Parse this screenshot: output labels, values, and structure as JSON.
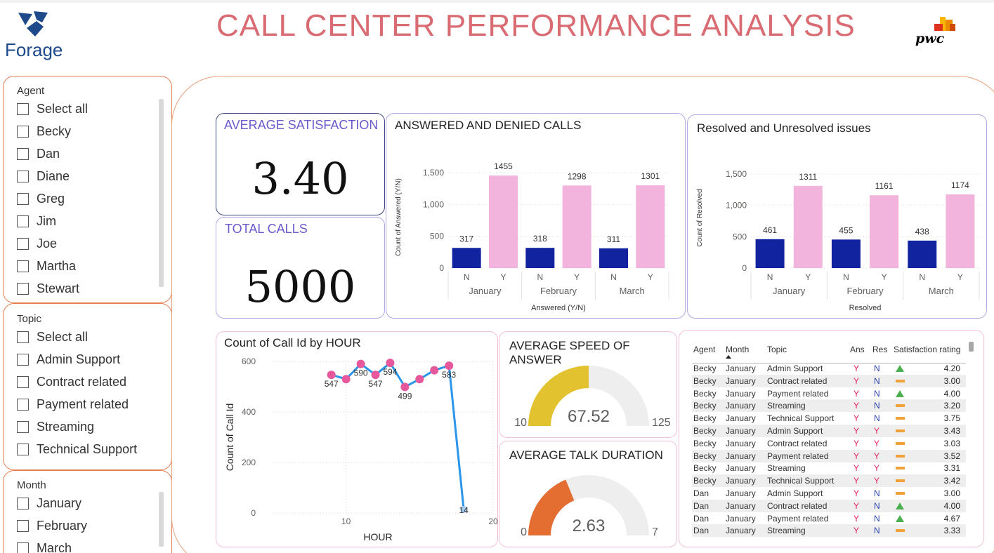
{
  "header": {
    "title": "CALL CENTER PERFORMANCE ANALYSIS",
    "logo_text": "Forage",
    "partner_logo_text": "pwc"
  },
  "slicers": {
    "agent": {
      "title": "Agent",
      "options": [
        "Select all",
        "Becky",
        "Dan",
        "Diane",
        "Greg",
        "Jim",
        "Joe",
        "Martha",
        "Stewart"
      ]
    },
    "topic": {
      "title": "Topic",
      "options": [
        "Select all",
        "Admin Support",
        "Contract related",
        "Payment related",
        "Streaming",
        "Technical Support"
      ]
    },
    "month": {
      "title": "Month",
      "options": [
        "January",
        "February",
        "March"
      ]
    }
  },
  "kpis": {
    "avg_satisfaction": {
      "label": "AVERAGE SATISFACTION",
      "value": "3.40"
    },
    "total_calls": {
      "label": "TOTAL CALLS",
      "value": "5000"
    }
  },
  "gauges": {
    "speed": {
      "label": "AVERAGE SPEED OF ANSWER",
      "min": "10",
      "max": "125",
      "value": "67.52",
      "value_num": 67.52,
      "color": "#e3c22f"
    },
    "talk": {
      "label": "AVERAGE TALK DURATION",
      "min": "0",
      "max": "7",
      "value": "2.63",
      "value_num": 2.63,
      "color": "#e46d32"
    }
  },
  "colors": {
    "dark_bar": "#1223a0",
    "pink_bar": "#f2b3dc",
    "line": "#2b95e9",
    "marker": "#e6579b",
    "accent": "#6a5acd"
  },
  "chart_data": [
    {
      "id": "answered",
      "type": "bar",
      "title": "ANSWERED AND DENIED CALLS",
      "xlabel": "Answered (Y/N)",
      "ylabel": "Count of Answered (Y/N)",
      "ylim": [
        0,
        1600
      ],
      "yticks": [
        "0",
        "500",
        "1,000",
        "1,500"
      ],
      "ytick_values": [
        0,
        500,
        1000,
        1500
      ],
      "groups": [
        "January",
        "February",
        "March"
      ],
      "categories": [
        "N",
        "Y",
        "N",
        "Y",
        "N",
        "Y"
      ],
      "values": [
        317,
        1455,
        318,
        1298,
        311,
        1301
      ],
      "labels": [
        "317",
        "1455",
        "318",
        "1298",
        "311",
        "1301"
      ],
      "grid": true
    },
    {
      "id": "resolved",
      "type": "bar",
      "title": "Resolved and Unresolved issues",
      "xlabel": "Resolved",
      "ylabel": "Count of Resolved",
      "ylim": [
        0,
        1600
      ],
      "yticks": [
        "0",
        "500",
        "1,000",
        "1,500"
      ],
      "ytick_values": [
        0,
        500,
        1000,
        1500
      ],
      "groups": [
        "January",
        "February",
        "March"
      ],
      "categories": [
        "N",
        "Y",
        "N",
        "Y",
        "N",
        "Y"
      ],
      "values": [
        461,
        1311,
        455,
        1161,
        438,
        1174
      ],
      "labels": [
        "461",
        "1311",
        "455",
        "1161",
        "438",
        "1174"
      ],
      "grid": true
    },
    {
      "id": "hourly",
      "type": "line",
      "title": "Count of Call Id by HOUR",
      "xlabel": "HOUR",
      "ylabel": "Count of Call Id",
      "xlim": [
        5,
        20
      ],
      "ylim": [
        0,
        600
      ],
      "xticks": [
        "10",
        "20"
      ],
      "xtick_values": [
        10,
        20
      ],
      "yticks": [
        "0",
        "200",
        "400",
        "600"
      ],
      "ytick_values": [
        0,
        200,
        400,
        600
      ],
      "x": [
        9,
        10,
        11,
        12,
        13,
        14,
        15,
        16,
        17,
        18
      ],
      "y": [
        547,
        530,
        590,
        547,
        594,
        499,
        530,
        565,
        583,
        14
      ],
      "labels": [
        "547",
        "",
        "590",
        "547",
        "594",
        "499",
        "",
        "",
        "583",
        "14"
      ],
      "grid": true
    }
  ],
  "table": {
    "headers": [
      "Agent",
      "Month",
      "Topic",
      "Ans",
      "Res",
      "Satisfaction rating"
    ],
    "rows": [
      {
        "agent": "Becky",
        "month": "January",
        "topic": "Admin Support",
        "ans": "Y",
        "res": "N",
        "trend": "up",
        "rating": "4.20"
      },
      {
        "agent": "Becky",
        "month": "January",
        "topic": "Contract related",
        "ans": "Y",
        "res": "N",
        "trend": "flat",
        "rating": "3.00"
      },
      {
        "agent": "Becky",
        "month": "January",
        "topic": "Payment related",
        "ans": "Y",
        "res": "N",
        "trend": "up",
        "rating": "4.00"
      },
      {
        "agent": "Becky",
        "month": "January",
        "topic": "Streaming",
        "ans": "Y",
        "res": "N",
        "trend": "flat",
        "rating": "3.20"
      },
      {
        "agent": "Becky",
        "month": "January",
        "topic": "Technical Support",
        "ans": "Y",
        "res": "N",
        "trend": "flat",
        "rating": "3.75"
      },
      {
        "agent": "Becky",
        "month": "January",
        "topic": "Admin Support",
        "ans": "Y",
        "res": "Y",
        "trend": "flat",
        "rating": "3.43"
      },
      {
        "agent": "Becky",
        "month": "January",
        "topic": "Contract related",
        "ans": "Y",
        "res": "Y",
        "trend": "flat",
        "rating": "3.03"
      },
      {
        "agent": "Becky",
        "month": "January",
        "topic": "Payment related",
        "ans": "Y",
        "res": "Y",
        "trend": "flat",
        "rating": "3.52"
      },
      {
        "agent": "Becky",
        "month": "January",
        "topic": "Streaming",
        "ans": "Y",
        "res": "Y",
        "trend": "flat",
        "rating": "3.31"
      },
      {
        "agent": "Becky",
        "month": "January",
        "topic": "Technical Support",
        "ans": "Y",
        "res": "Y",
        "trend": "flat",
        "rating": "3.42"
      },
      {
        "agent": "Dan",
        "month": "January",
        "topic": "Admin Support",
        "ans": "Y",
        "res": "N",
        "trend": "flat",
        "rating": "3.00"
      },
      {
        "agent": "Dan",
        "month": "January",
        "topic": "Contract related",
        "ans": "Y",
        "res": "N",
        "trend": "up",
        "rating": "4.00"
      },
      {
        "agent": "Dan",
        "month": "January",
        "topic": "Payment related",
        "ans": "Y",
        "res": "N",
        "trend": "up",
        "rating": "4.67"
      },
      {
        "agent": "Dan",
        "month": "January",
        "topic": "Streaming",
        "ans": "Y",
        "res": "N",
        "trend": "flat",
        "rating": "3.33"
      }
    ]
  }
}
